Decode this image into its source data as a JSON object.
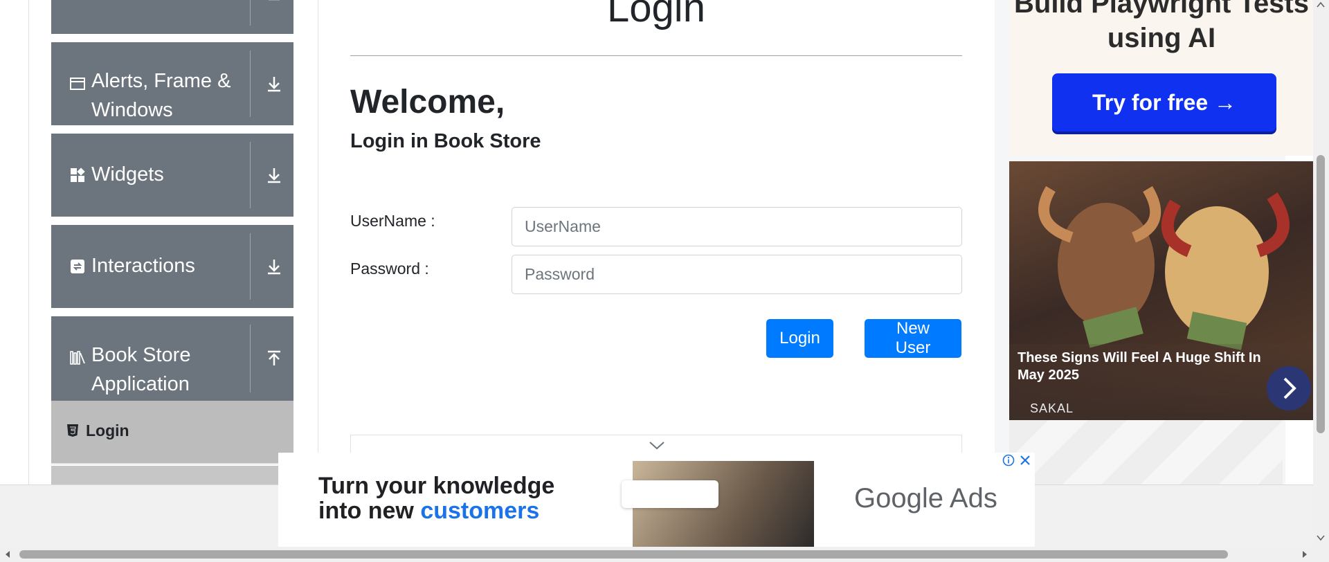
{
  "sidebar": {
    "groups": [
      {
        "label": "",
        "icon": "document-icon",
        "expanded": false
      },
      {
        "label": "Alerts, Frame & Windows",
        "icon": "browser-window-icon",
        "expanded": false
      },
      {
        "label": "Widgets",
        "icon": "widgets-icon",
        "expanded": false
      },
      {
        "label": "Interactions",
        "icon": "interactions-icon",
        "expanded": false
      },
      {
        "label": "Book Store Application",
        "icon": "books-icon",
        "expanded": true
      }
    ],
    "active_item": {
      "label": "Login",
      "icon": "html5-icon"
    }
  },
  "main": {
    "page_title": "Login",
    "welcome": "Welcome,",
    "subtitle": "Login in Book Store",
    "username_label": "UserName :",
    "username_placeholder": "UserName",
    "password_label": "Password :",
    "password_placeholder": "Password",
    "login_button": "Login",
    "new_user_button": "New User"
  },
  "ads": {
    "top_headline": "Build Playwright Tests using AI",
    "top_cta": "Try for free →",
    "image_caption": "These Signs Will Feel A Huge Shift In May 2025",
    "image_source": "SAKAL",
    "bottom_text_line1": "Turn your knowledge",
    "bottom_text_line2_plain": "into new ",
    "bottom_text_line2_accent": "customers",
    "bottom_brand": "Google Ads",
    "colors": {
      "cta": "#1031f0",
      "primary_button": "#007bff",
      "sidebar": "#6c757d"
    }
  }
}
